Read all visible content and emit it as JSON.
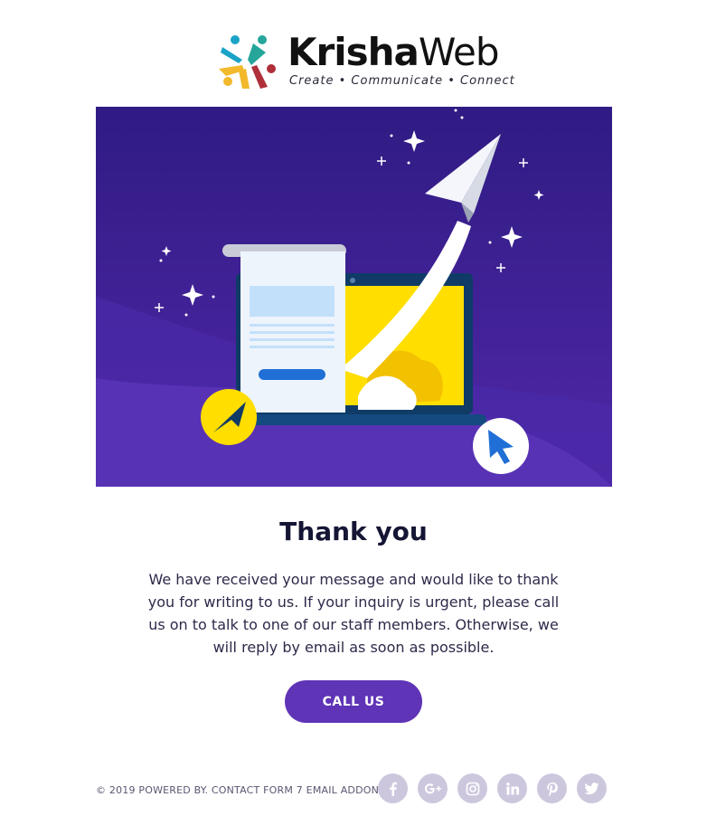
{
  "brand": {
    "name_bold": "Krisha",
    "name_light": "Web",
    "tagline": "Create • Communicate • Connect",
    "colors": [
      "#1aa3c7",
      "#26a69a",
      "#f2b92c",
      "#b0303a",
      "#6a2a8a"
    ]
  },
  "hero": {
    "background": "#3b1f9a",
    "accent_yellow": "#ffde00",
    "accent_blue": "#1f6fd6",
    "icons": [
      "paper-plane-icon",
      "laptop-icon",
      "document-icon",
      "cursor-arrow-icon"
    ]
  },
  "content": {
    "title": "Thank you",
    "message": "We have received your message and would like to thank you for writing to us. If your inquiry is urgent, please call us on to talk to one of our staff members. Otherwise, we will reply by email as soon as possible.",
    "cta_label": "CALL US",
    "cta_color": "#5f34b6"
  },
  "footer": {
    "copyright": "© 2019 POWERED BY. CONTACT FORM 7 EMAIL ADDON.",
    "socials": [
      "facebook-icon",
      "google-plus-icon",
      "instagram-icon",
      "linkedin-icon",
      "pinterest-icon",
      "twitter-icon"
    ],
    "social_bg": "#cdc7de"
  }
}
